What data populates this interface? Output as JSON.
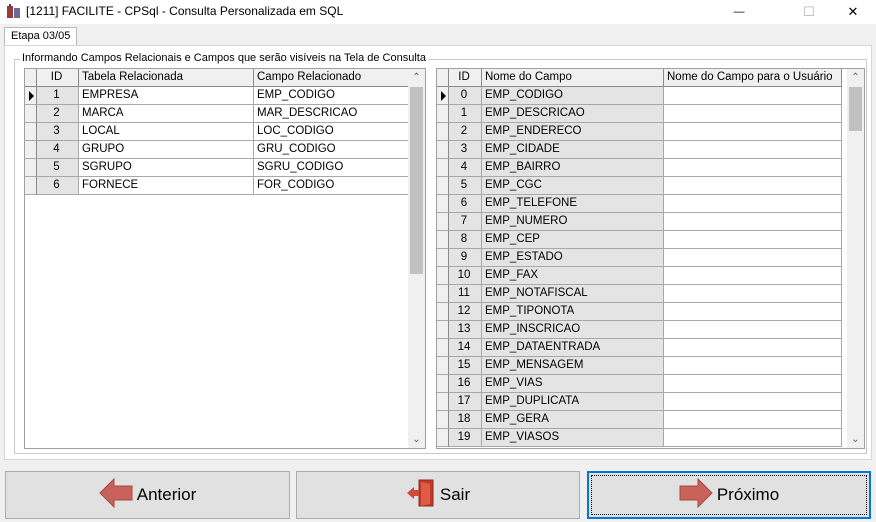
{
  "window": {
    "title": "[1211] FACILITE - CPSql - Consulta Personalizada em SQL",
    "minimize_glyph": "—",
    "maximize_glyph": "☐",
    "close_glyph": "✕"
  },
  "tab": {
    "label": "Etapa 03/05"
  },
  "group": {
    "caption": "Informando Campos Relacionais e Campos que serão visíveis na Tela de Consulta"
  },
  "left_grid": {
    "columns": [
      "ID",
      "Tabela Relacionada",
      "Campo Relacionado"
    ],
    "rows": [
      {
        "id": "1",
        "tabela": "EMPRESA",
        "campo": "EMP_CODIGO"
      },
      {
        "id": "2",
        "tabela": "MARCA",
        "campo": "MAR_DESCRICAO"
      },
      {
        "id": "3",
        "tabela": "LOCAL",
        "campo": "LOC_CODIGO"
      },
      {
        "id": "4",
        "tabela": "GRUPO",
        "campo": "GRU_CODIGO"
      },
      {
        "id": "5",
        "tabela": "SGRUPO",
        "campo": "SGRU_CODIGO"
      },
      {
        "id": "6",
        "tabela": "FORNECE",
        "campo": "FOR_CODIGO"
      }
    ]
  },
  "right_grid": {
    "columns": [
      "ID",
      "Nome do Campo",
      "Nome do Campo para o Usuário"
    ],
    "rows": [
      {
        "id": "0",
        "campo": "EMP_CODIGO",
        "usuario": ""
      },
      {
        "id": "1",
        "campo": "EMP_DESCRICAO",
        "usuario": ""
      },
      {
        "id": "2",
        "campo": "EMP_ENDERECO",
        "usuario": ""
      },
      {
        "id": "3",
        "campo": "EMP_CIDADE",
        "usuario": ""
      },
      {
        "id": "4",
        "campo": "EMP_BAIRRO",
        "usuario": ""
      },
      {
        "id": "5",
        "campo": "EMP_CGC",
        "usuario": ""
      },
      {
        "id": "6",
        "campo": "EMP_TELEFONE",
        "usuario": ""
      },
      {
        "id": "7",
        "campo": "EMP_NUMERO",
        "usuario": ""
      },
      {
        "id": "8",
        "campo": "EMP_CEP",
        "usuario": ""
      },
      {
        "id": "9",
        "campo": "EMP_ESTADO",
        "usuario": ""
      },
      {
        "id": "10",
        "campo": "EMP_FAX",
        "usuario": ""
      },
      {
        "id": "11",
        "campo": "EMP_NOTAFISCAL",
        "usuario": ""
      },
      {
        "id": "12",
        "campo": "EMP_TIPONOTA",
        "usuario": ""
      },
      {
        "id": "13",
        "campo": "EMP_INSCRICAO",
        "usuario": ""
      },
      {
        "id": "14",
        "campo": "EMP_DATAENTRADA",
        "usuario": ""
      },
      {
        "id": "15",
        "campo": "EMP_MENSAGEM",
        "usuario": ""
      },
      {
        "id": "16",
        "campo": "EMP_VIAS",
        "usuario": ""
      },
      {
        "id": "17",
        "campo": "EMP_DUPLICATA",
        "usuario": ""
      },
      {
        "id": "18",
        "campo": "EMP_GERA",
        "usuario": ""
      },
      {
        "id": "19",
        "campo": "EMP_VIASOS",
        "usuario": ""
      }
    ]
  },
  "buttons": {
    "anterior": "Anterior",
    "sair": "Sair",
    "proximo": "Próximo"
  },
  "icons": {
    "app": "app-icon",
    "anterior": "arrow-left-icon",
    "sair": "exit-door-icon",
    "proximo": "arrow-right-icon"
  },
  "colors": {
    "arrow_red": "#c8625a",
    "focus_border": "#0078d7"
  }
}
